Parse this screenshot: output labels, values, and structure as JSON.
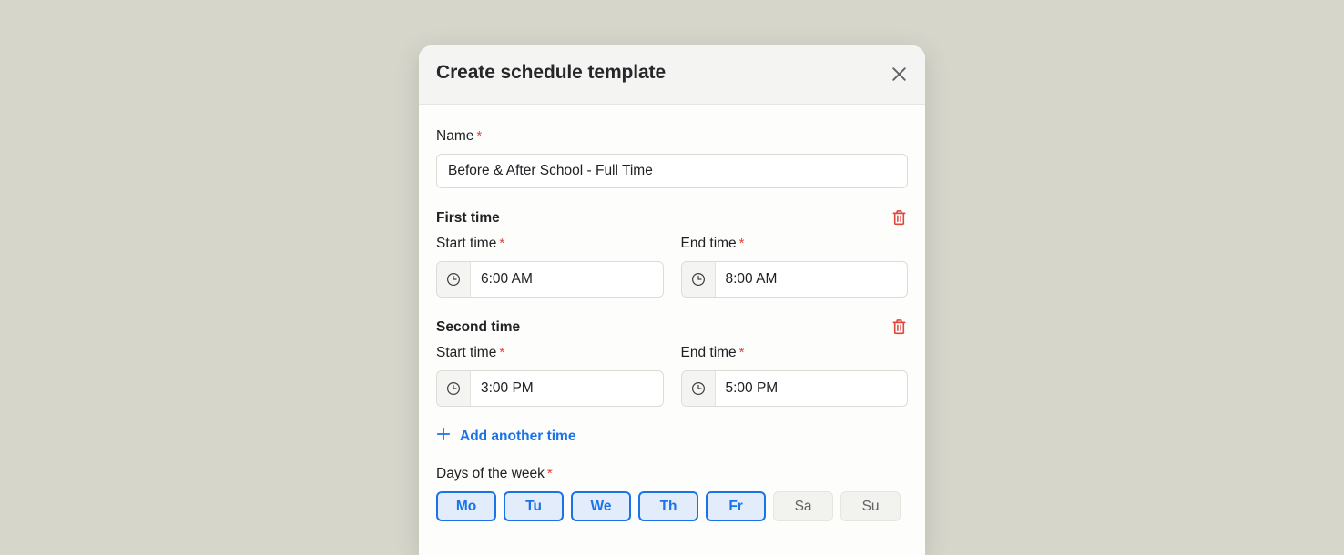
{
  "modal": {
    "title": "Create schedule template",
    "close_icon": "close-icon",
    "name_field": {
      "label": "Name",
      "required_marker": "*",
      "value": "Before & After School - Full Time"
    },
    "time_groups": [
      {
        "title": "First time",
        "delete_icon": "trash-icon",
        "start": {
          "label": "Start time",
          "required_marker": "*",
          "icon": "clock-icon",
          "value": "6:00 AM"
        },
        "end": {
          "label": "End time",
          "required_marker": "*",
          "icon": "clock-icon",
          "value": "8:00 AM"
        }
      },
      {
        "title": "Second time",
        "delete_icon": "trash-icon",
        "start": {
          "label": "Start time",
          "required_marker": "*",
          "icon": "clock-icon",
          "value": "3:00 PM"
        },
        "end": {
          "label": "End time",
          "required_marker": "*",
          "icon": "clock-icon",
          "value": "5:00 PM"
        }
      }
    ],
    "add_time": {
      "icon": "plus-icon",
      "label": "Add another time"
    },
    "days": {
      "label": "Days of the week",
      "required_marker": "*",
      "items": [
        {
          "label": "Mo",
          "selected": true
        },
        {
          "label": "Tu",
          "selected": true
        },
        {
          "label": "We",
          "selected": true
        },
        {
          "label": "Th",
          "selected": true
        },
        {
          "label": "Fr",
          "selected": true
        },
        {
          "label": "Sa",
          "selected": false
        },
        {
          "label": "Su",
          "selected": false
        }
      ]
    }
  },
  "colors": {
    "page_background": "#d6d6cb",
    "modal_background": "#fdfdfb",
    "header_background": "#f4f4f2",
    "accent_blue": "#1a73e8",
    "selected_chip_fill": "#e3ecfb",
    "required_red": "#e0443b",
    "delete_red": "#e0443b",
    "text_primary": "#202124",
    "text_muted": "#5f6368"
  }
}
